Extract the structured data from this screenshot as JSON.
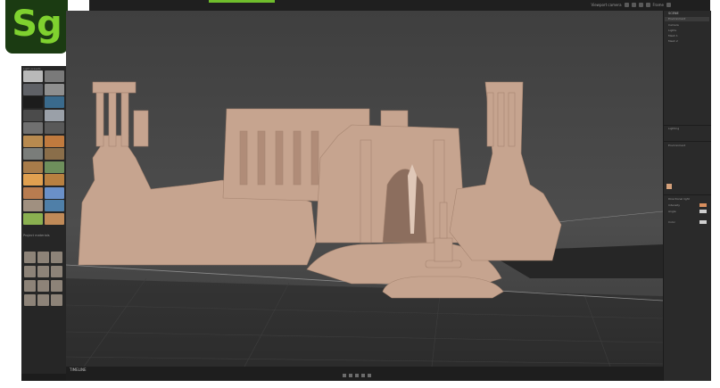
{
  "app": {
    "logo_text": "Sg",
    "brand_color": "#6fbd2c",
    "logo_bg": "#1b3b12"
  },
  "topbar": {
    "labels": [
      "Viewport camera",
      "Frame"
    ],
    "tool_icons": [
      "move-icon",
      "rotate-icon",
      "scale-icon",
      "camera-icon",
      "frame-icon"
    ]
  },
  "left_panel": {
    "header": "Light presets",
    "section_title": "Project materials",
    "environment_thumbs": [
      "#b9b9b9",
      "#7a7a7a",
      "#5f6166",
      "#8f8f8f",
      "#1c1c1c",
      "#3a6a8c",
      "#4b4b4b",
      "#9aa0a8",
      "#707070",
      "#595959",
      "#b88a4f",
      "#c07a3e",
      "#7a7d7a",
      "#8a6e4a",
      "#a87c4a",
      "#6e8f5c",
      "#e0a050",
      "#b88040",
      "#b87c50",
      "#6a90c8",
      "#a09080",
      "#4f7fa8",
      "#8ab050",
      "#c08a58"
    ],
    "material_count": 12,
    "material_color": "#8d8378"
  },
  "viewport": {
    "scene": "ancient-ruins-render",
    "background_color": "#4a4a4a",
    "stone_color": "#c9aa96"
  },
  "timeline": {
    "label": "TIMELINE"
  },
  "right_panel": {
    "title": "SCENE",
    "tree_items": [
      "Environment",
      "Camera",
      "Lights",
      "Mesh 1",
      "Mesh 2"
    ],
    "sections": [
      "Lighting",
      "Environment",
      "Directional light"
    ],
    "properties": [
      "Intensity",
      "Angle",
      "Color"
    ],
    "accent_color": "#d98f5e"
  }
}
